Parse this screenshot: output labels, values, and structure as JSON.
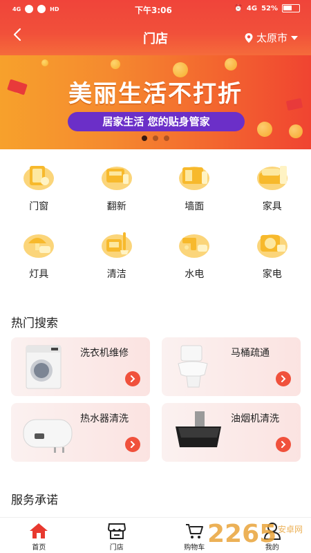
{
  "status_bar": {
    "left_chips": [
      "4G",
      "HD"
    ],
    "time": "下午3:06",
    "right_text": "4G",
    "battery": "52%"
  },
  "navbar": {
    "title": "门店",
    "city": "太原市"
  },
  "banner": {
    "headline": "美丽生活不打折",
    "pill_text": "居家生活 您的贴身管家",
    "page_count": 3,
    "active_page": 1
  },
  "categories": [
    {
      "label": "门窗",
      "icon": "door-window-icon"
    },
    {
      "label": "翻新",
      "icon": "renovation-icon"
    },
    {
      "label": "墙面",
      "icon": "wall-icon"
    },
    {
      "label": "家具",
      "icon": "furniture-icon"
    },
    {
      "label": "灯具",
      "icon": "lamp-icon"
    },
    {
      "label": "清洁",
      "icon": "cleaning-icon"
    },
    {
      "label": "水电",
      "icon": "plumbing-electric-icon"
    },
    {
      "label": "家电",
      "icon": "appliance-icon"
    }
  ],
  "hot_search": {
    "title": "热门搜索",
    "items": [
      {
        "label": "洗衣机维修",
        "image": "washing-machine"
      },
      {
        "label": "马桶疏通",
        "image": "toilet"
      },
      {
        "label": "热水器清洗",
        "image": "water-heater"
      },
      {
        "label": "油烟机清洗",
        "image": "range-hood"
      }
    ]
  },
  "service": {
    "title": "服务承诺"
  },
  "tabs": [
    {
      "label": "首页",
      "icon": "home-icon",
      "active": true
    },
    {
      "label": "门店",
      "icon": "store-icon",
      "active": false
    },
    {
      "label": "购物车",
      "icon": "cart-icon",
      "active": false
    },
    {
      "label": "我的",
      "icon": "profile-icon",
      "active": false
    }
  ],
  "colors": {
    "brand_red": "#f0443a",
    "accent_orange": "#f58a2f",
    "pill_purple": "#6b2fc8",
    "icon_yellow": "#f8c23a"
  },
  "watermark": {
    "text": "2265",
    "sub": "安卓网"
  }
}
